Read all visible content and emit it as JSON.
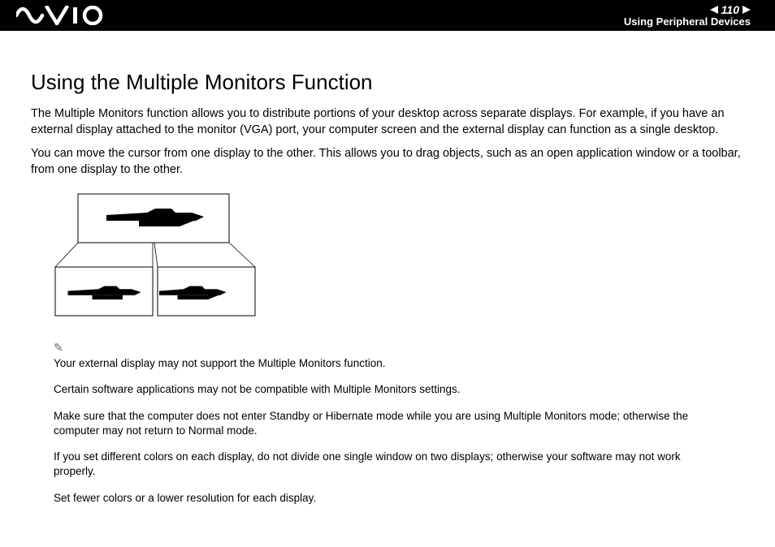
{
  "header": {
    "page_number": "110",
    "section": "Using Peripheral Devices"
  },
  "title": "Using the Multiple Monitors Function",
  "paragraphs": [
    "The Multiple Monitors function allows you to distribute portions of your desktop across separate displays. For example, if you have an external display attached to the monitor (VGA) port, your computer screen and the external display can function as a single desktop.",
    "You can move the cursor from one display to the other. This allows you to drag objects, such as an open application window or a toolbar, from one display to the other."
  ],
  "notes": [
    "Your external display may not support the Multiple Monitors function.",
    "Certain software applications may not be compatible with Multiple Monitors settings.",
    "Make sure that the computer does not enter Standby or Hibernate mode while you are using Multiple Monitors mode; otherwise the computer may not return to Normal mode.",
    "If you set different colors on each display, do not divide one single window on two displays; otherwise your software may not work properly.",
    "Set fewer colors or a lower resolution for each display."
  ]
}
